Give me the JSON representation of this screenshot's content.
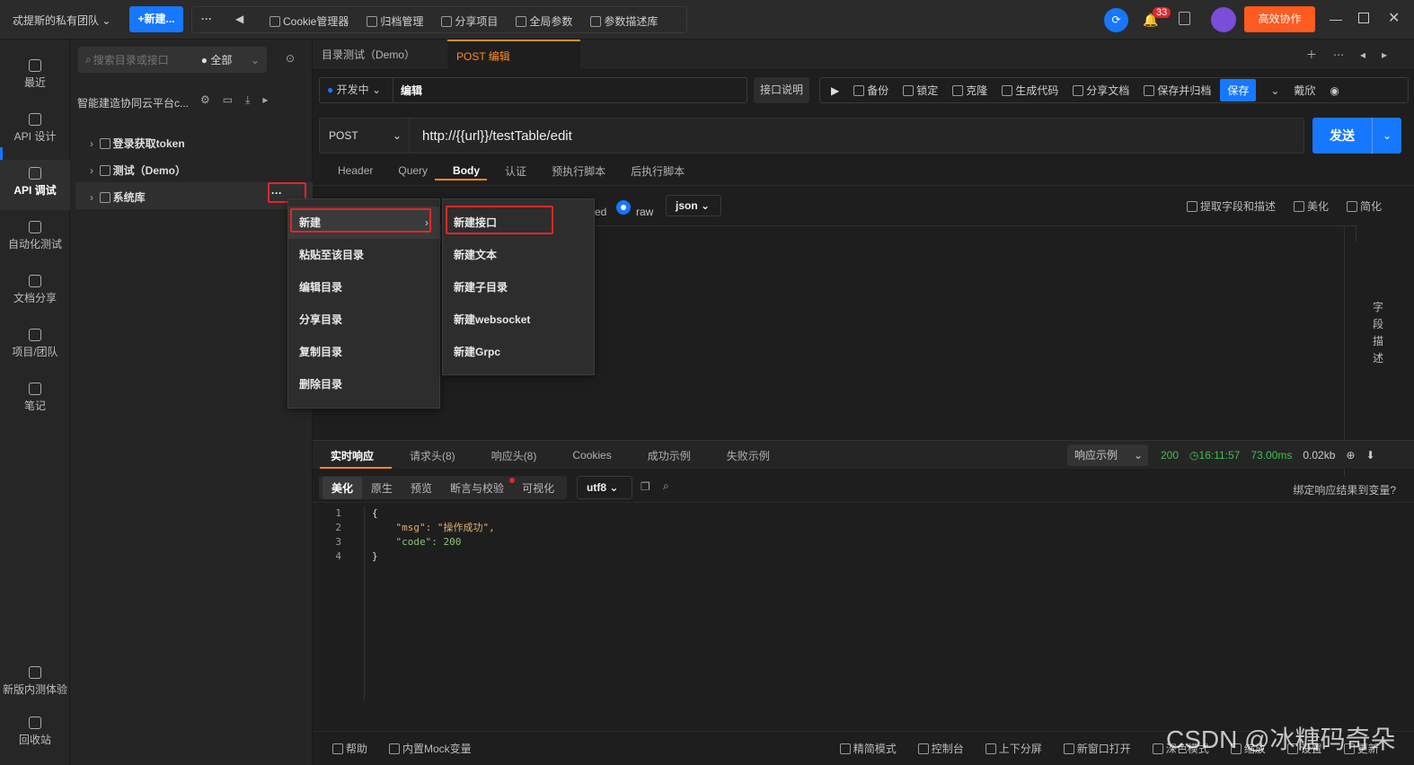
{
  "topbar": {
    "team": "忒提斯的私有团队",
    "new_btn": "+新建...",
    "more": "···",
    "tools": [
      "Cookie管理器",
      "归档管理",
      "分享项目",
      "全局参数",
      "参数描述库"
    ],
    "badge": "33",
    "collab_btn": "高效协作"
  },
  "leftnav": [
    {
      "icon": "clock-icon",
      "label": "最近"
    },
    {
      "icon": "edit-icon",
      "label": "API 设计"
    },
    {
      "icon": "link-icon",
      "label": "API 调试"
    },
    {
      "icon": "robot-icon",
      "label": "自动化测试"
    },
    {
      "icon": "doc-icon",
      "label": "文档分享"
    },
    {
      "icon": "team-icon",
      "label": "项目/团队"
    },
    {
      "icon": "note-icon",
      "label": "笔记"
    },
    {
      "icon": "beta-icon",
      "label": "新版内测体验"
    },
    {
      "icon": "trash-icon",
      "label": "回收站"
    }
  ],
  "tree": {
    "search_placeholder": "搜索目录或接口",
    "filter": "● 全部",
    "project": "智能建造协同云平台c...",
    "folders": [
      "登录获取token",
      "测试（Demo）",
      "系统库"
    ],
    "folder_more": "···"
  },
  "context_menu": {
    "items": [
      "新建",
      "粘贴至该目录",
      "编辑目录",
      "分享目录",
      "复制目录",
      "删除目录"
    ],
    "submenu": [
      "新建接口",
      "新建文本",
      "新建子目录",
      "新建websocket",
      "新建Grpc"
    ]
  },
  "tabs": [
    "目录测试（Demo）",
    "POST 编辑"
  ],
  "request": {
    "env": "开发中",
    "name": "编辑",
    "doc_btn": "接口说明",
    "actions": [
      "备份",
      "锁定",
      "克隆",
      "生成代码",
      "分享文档",
      "保存并归档"
    ],
    "save": "保存",
    "style": "戴欣",
    "method": "POST",
    "url": "http://{{url}}/testTable/edit",
    "send": "发送"
  },
  "req_tabs": [
    "Header",
    "Query",
    "Body",
    "认证",
    "预执行脚本",
    "后执行脚本"
  ],
  "body_opts": {
    "partial": "ed",
    "raw": "raw",
    "format": "json",
    "right": [
      "提取字段和描述",
      "美化",
      "简化"
    ]
  },
  "side_label": "字段描述",
  "resp_tabs": [
    "实时响应",
    "请求头(8)",
    "响应头(8)",
    "Cookies",
    "成功示例",
    "失败示例"
  ],
  "resp_meta": {
    "example": "响应示例",
    "status": "200",
    "time": "16:11:57",
    "duration": "73.00ms",
    "size": "0.02kb"
  },
  "resp_sub": [
    "美化",
    "原生",
    "预览",
    "断言与校验",
    "可视化"
  ],
  "encoding": "utf8",
  "bind_var": "绑定响应结果到变量?",
  "code_lines": [
    "{",
    "    \"msg\": \"操作成功\",",
    "    \"code\": 200",
    "}"
  ],
  "line_nums": [
    "1",
    "2",
    "3",
    "4"
  ],
  "footer": [
    "帮助",
    "内置Mock变量",
    "精简模式",
    "控制台",
    "上下分屏",
    "新窗口打开",
    "深色模式",
    "缩放",
    "设置",
    "更新"
  ],
  "watermark": "CSDN @冰糖码奇朵"
}
